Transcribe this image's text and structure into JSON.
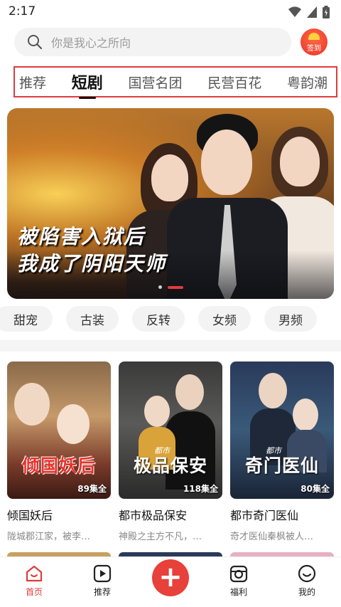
{
  "status_bar": {
    "time": "2:17"
  },
  "search": {
    "placeholder": "你是我心之所向"
  },
  "checkin": {
    "label": "签到"
  },
  "tabs": [
    {
      "label": "推荐",
      "active": false
    },
    {
      "label": "短剧",
      "active": true
    },
    {
      "label": "国营名团",
      "active": false
    },
    {
      "label": "民营百花",
      "active": false
    },
    {
      "label": "粤韵潮",
      "active": false
    }
  ],
  "banner": {
    "title_line1": "被陷害入狱后",
    "title_line2": "我成了阴阳天师",
    "slide_index": 2,
    "slide_count": 2
  },
  "chips": [
    "甜宠",
    "古装",
    "反转",
    "女频",
    "男频"
  ],
  "cards": [
    {
      "cover_title": "倾国妖后",
      "cover_sub": "",
      "episodes": "89集全",
      "name": "倾国妖后",
      "desc": "陇城郡江家，被李…",
      "cover_title_color": "#e8322a"
    },
    {
      "cover_title": "极品保安",
      "cover_sub": "都市",
      "episodes": "118集全",
      "name": "都市极品保安",
      "desc": "神殿之主方不凡，…",
      "cover_title_color": "#ffffff"
    },
    {
      "cover_title": "奇门医仙",
      "cover_sub": "都市",
      "episodes": "80集全",
      "name": "都市奇门医仙",
      "desc": "奇才医仙秦枫被人…",
      "cover_title_color": "#ffffff"
    }
  ],
  "bottom_nav": [
    {
      "label": "首页",
      "icon": "home-icon",
      "active": true
    },
    {
      "label": "推荐",
      "icon": "play-icon",
      "active": false
    },
    {
      "label": "福利",
      "icon": "gift-icon",
      "active": false
    },
    {
      "label": "我的",
      "icon": "smile-icon",
      "active": false
    }
  ],
  "colors": {
    "accent": "#e03b3b",
    "fab": "#e8403a"
  }
}
